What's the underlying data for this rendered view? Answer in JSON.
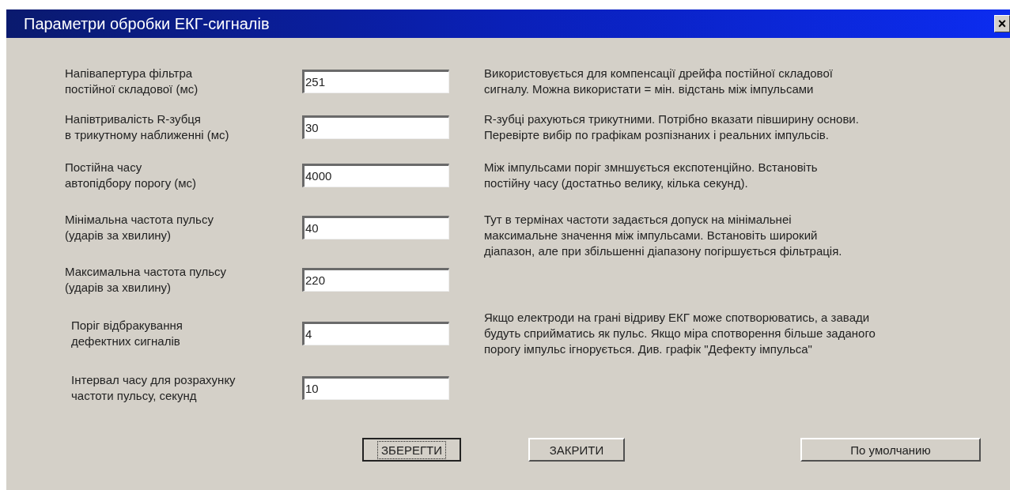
{
  "window": {
    "title": "Параметри обробки ЕКГ-сигналів",
    "close": "×"
  },
  "rows": [
    {
      "label": "Напівапертура фільтра\nпостійної складової (мс)",
      "value": "251",
      "description": "Використовується для компенсації дрейфа постійної складової\nсигналу. Можна використати = мін. відстань між імпульсами"
    },
    {
      "label": "Напівтривалість R-зубця\nв трикутному наближенні (мс)",
      "value": "30",
      "description": "R-зубці рахуються трикутними. Потрібно вказати півширину основи.\nПеревірте вибір по графікам розпізнаних і реальних імпульсів."
    },
    {
      "label": "Постійна часу\nавтопідбору порогу (мс)",
      "value": "4000",
      "description": "Між імпульсами поріг змншується експотенційно. Встановіть\nпостійну часу (достатньо велику, кілька секунд)."
    },
    {
      "label": "Мінімальна частота пульсу\n(ударів за хвилину)",
      "value": "40",
      "description": "Тут в термінах частоти задається допуск на мінімальнеі\nмаксимальне значення між імпульсами. Встановіть широкий\nдіапазон, але при збільшенні діапазону погіршується фільтрація."
    },
    {
      "label": "Максимальна частота пульсу\n(ударів за хвилину)",
      "value": "220"
    },
    {
      "label": "Поріг відбракування\nдефектних сигналів",
      "value": "4",
      "description": "Якщо електроди на грані відриву ЕКГ може спотворюватись, а завади\nбудуть сприйматись як пульс. Якщо міра спотворення більше заданого\nпорогу імпульс ігнорується. Див. графік \"Дефекту імпульса\""
    },
    {
      "label": "Інтервал часу для розрахунку\nчастоти пульсу, секунд",
      "value": "10"
    }
  ],
  "buttons": [
    {
      "label": "ЗБЕРЕГТИ",
      "default": true
    },
    {
      "label": "ЗАКРИТИ",
      "default": false
    },
    {
      "label": "По умолчанию",
      "default": false
    }
  ]
}
